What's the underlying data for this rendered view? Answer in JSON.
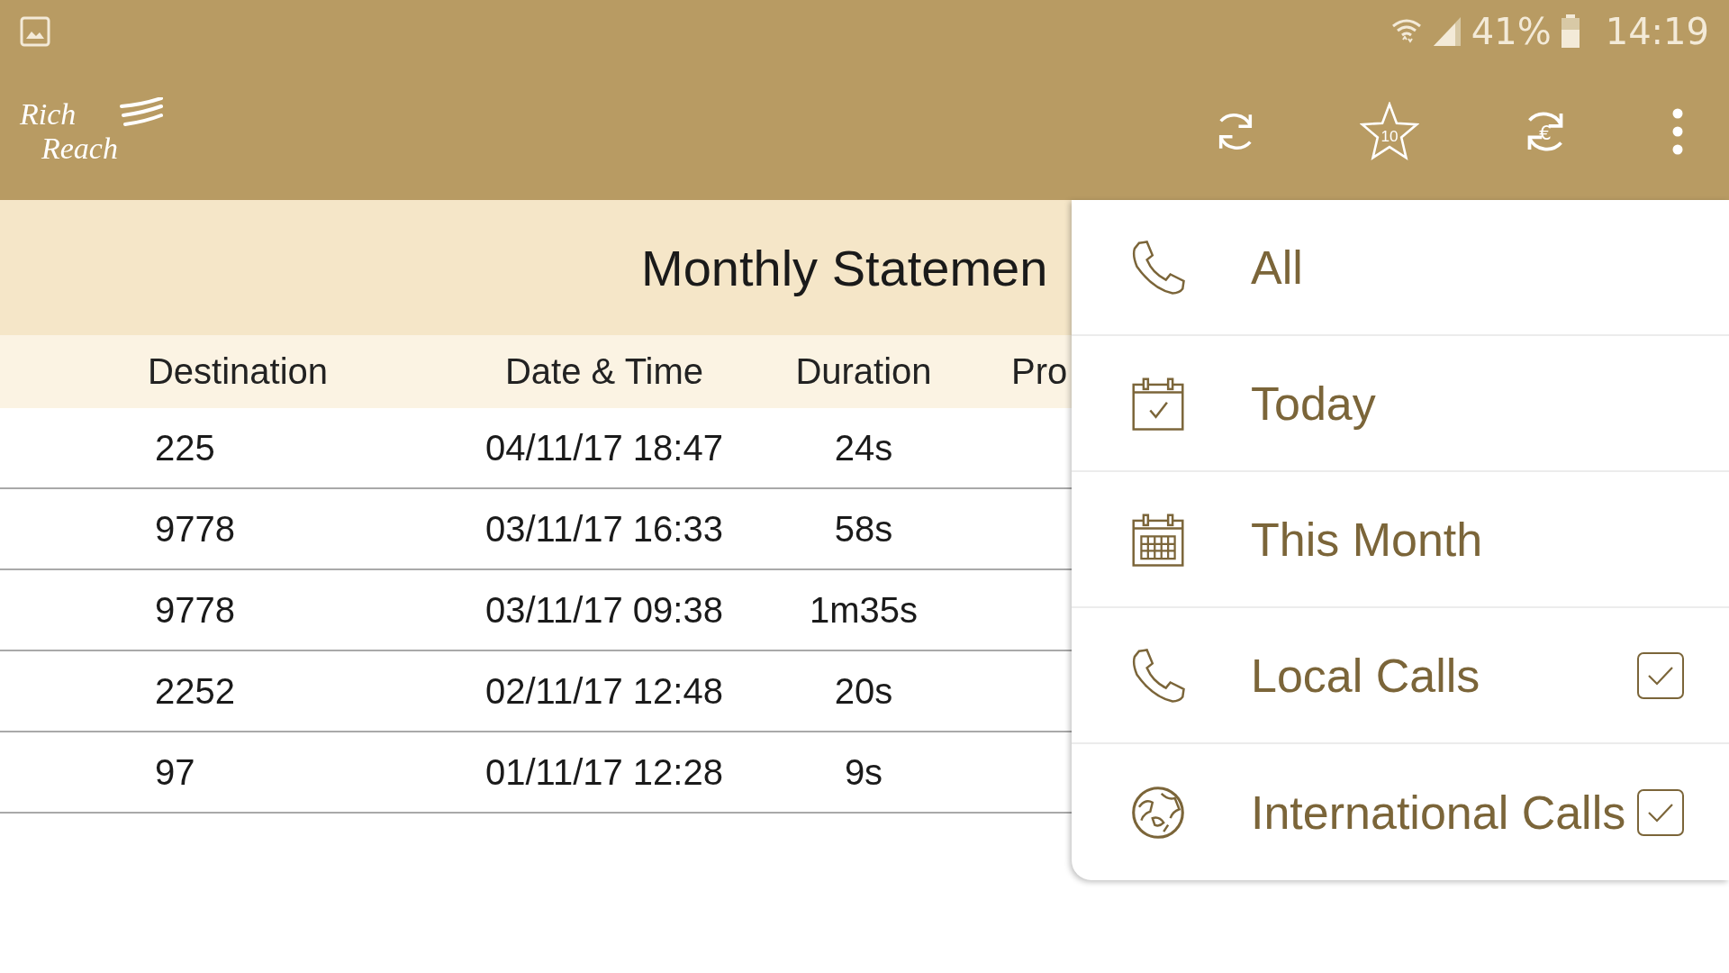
{
  "status_bar": {
    "battery": "41%",
    "time": "14:19"
  },
  "app_bar": {
    "logo": [
      "Rich",
      "Reach"
    ],
    "points_badge": "10",
    "currency_symbol": "€"
  },
  "title": "Monthly Statemen",
  "table": {
    "columns": [
      "Destination",
      "Date & Time",
      "Duration",
      "Pro"
    ],
    "rows": [
      {
        "destination": "225",
        "datetime": "04/11/17 18:47",
        "duration": "24s"
      },
      {
        "destination": "9778",
        "datetime": "03/11/17 16:33",
        "duration": "58s"
      },
      {
        "destination": "9778",
        "datetime": "03/11/17 09:38",
        "duration": "1m35s"
      },
      {
        "destination": "2252",
        "datetime": "02/11/17 12:48",
        "duration": "20s"
      },
      {
        "destination": "97",
        "datetime": "01/11/17 12:28",
        "duration": "9s"
      }
    ]
  },
  "menu": {
    "items": [
      {
        "label": "All",
        "kind": "filter"
      },
      {
        "label": "Today",
        "kind": "filter"
      },
      {
        "label": "This Month",
        "kind": "filter"
      },
      {
        "label": "Local Calls",
        "kind": "toggle",
        "checked": true
      },
      {
        "label": "International Calls",
        "kind": "toggle",
        "checked": true
      }
    ]
  }
}
